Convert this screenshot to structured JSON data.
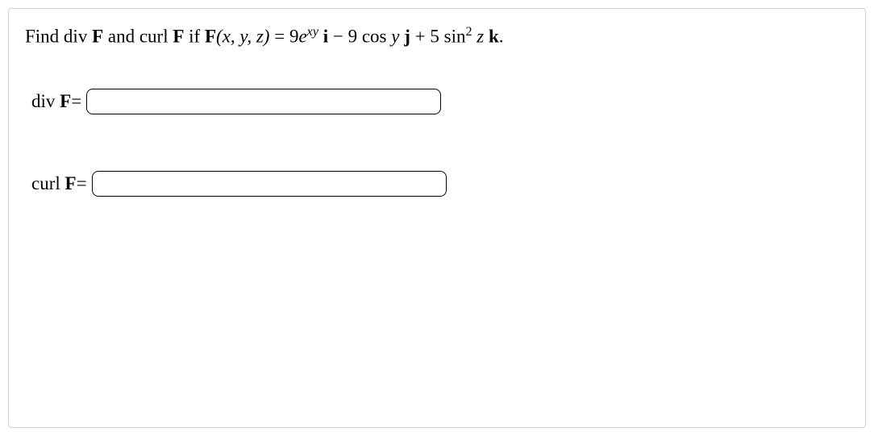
{
  "question": {
    "prefix": "Find div ",
    "F1": "F",
    "mid1": " and curl ",
    "F2": "F",
    "mid2": " if ",
    "F3": "F",
    "args": "(x, y, z)",
    "eq": " = 9",
    "e": "e",
    "exp_xy": "xy",
    "space_i": " ",
    "i": "i",
    "minus": " − 9 cos ",
    "y": "y ",
    "j": "j",
    "plus": " + 5 sin",
    "sq": "2",
    "sp_z": " ",
    "z": "z ",
    "k": "k",
    "period": "."
  },
  "fields": {
    "div": {
      "label_pre": "div ",
      "label_F": "F",
      "label_post": "=",
      "value": ""
    },
    "curl": {
      "label_pre": "curl ",
      "label_F": "F",
      "label_post": "=",
      "value": ""
    }
  }
}
